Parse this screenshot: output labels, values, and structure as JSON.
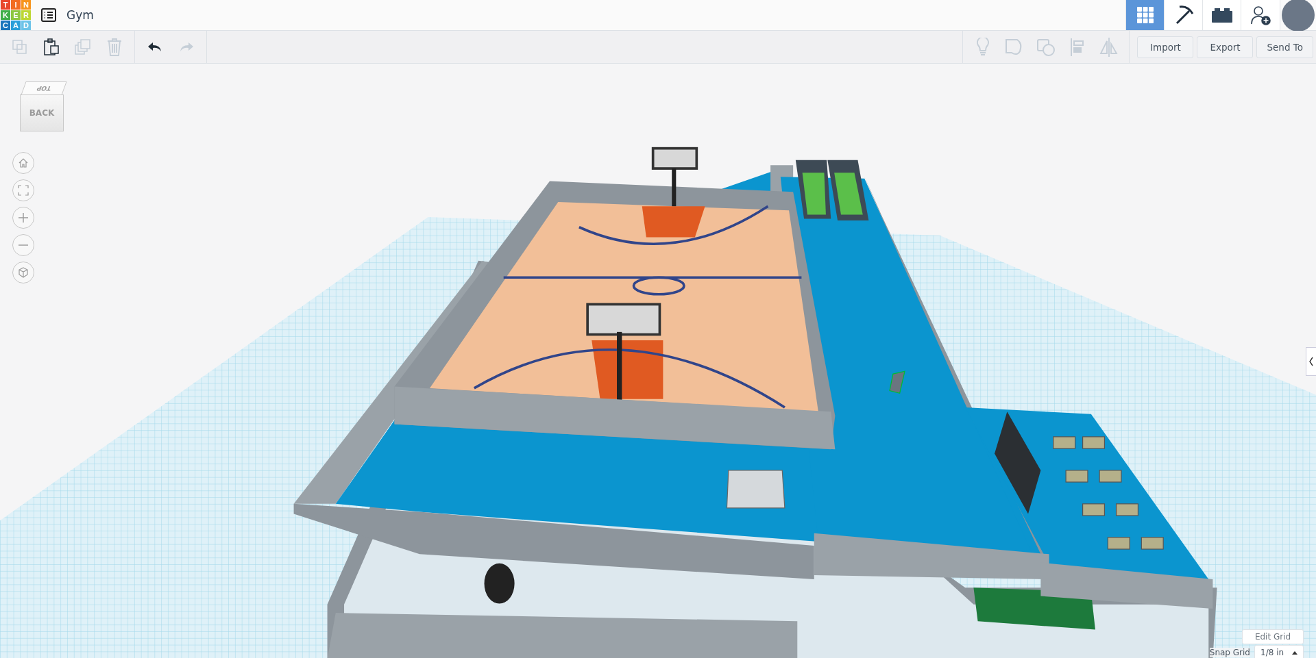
{
  "header": {
    "logo_letters": [
      "T",
      "I",
      "N",
      "K",
      "E",
      "R",
      "C",
      "A",
      "D"
    ],
    "project_title": "Gym"
  },
  "view_modes": [
    {
      "kind": "grid",
      "selected": true
    },
    {
      "kind": "pickaxe",
      "selected": false
    },
    {
      "kind": "brick",
      "selected": false
    }
  ],
  "toolbar": {
    "edit_tools": [
      {
        "kind": "copy",
        "disabled": true
      },
      {
        "kind": "paste",
        "disabled": false
      },
      {
        "kind": "duplicate",
        "disabled": true
      },
      {
        "kind": "delete",
        "disabled": true
      }
    ],
    "history": [
      {
        "kind": "undo",
        "disabled": false
      },
      {
        "kind": "redo",
        "disabled": true
      }
    ],
    "shape_tools": [
      {
        "kind": "light",
        "disabled": true
      },
      {
        "kind": "group",
        "disabled": true
      },
      {
        "kind": "ungroup",
        "disabled": true
      },
      {
        "kind": "align",
        "disabled": true
      },
      {
        "kind": "mirror",
        "disabled": true
      }
    ],
    "buttons": [
      "Import",
      "Export",
      "Send To"
    ]
  },
  "view_cube": {
    "top_face": "TOP",
    "front_face": "BACK"
  },
  "grid_controls": {
    "edit_button": "Edit Grid",
    "snap_label": "Snap Grid",
    "snap_value": "1/8 in"
  }
}
